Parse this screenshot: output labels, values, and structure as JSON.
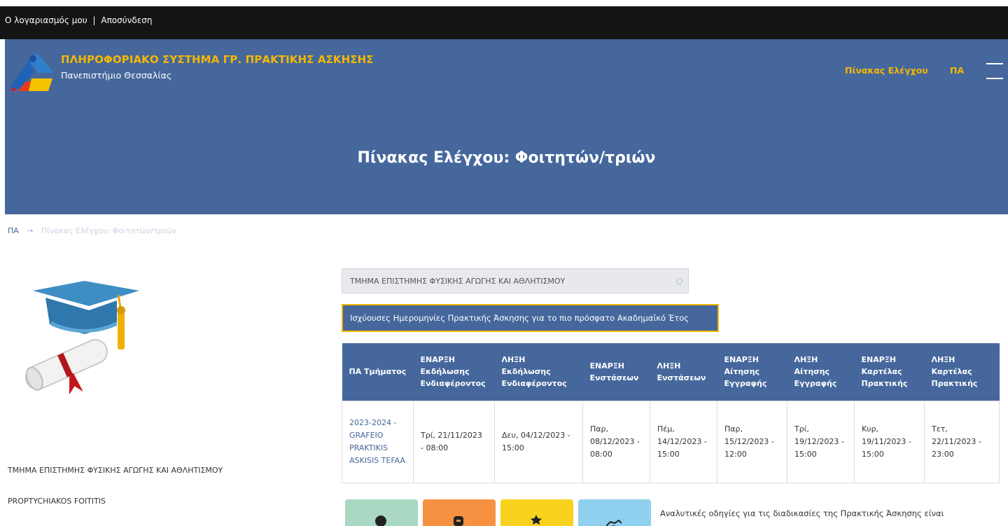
{
  "topbar": {
    "account_link": "Ο λογαριασμός μου",
    "separator": "|",
    "logout_link": "Αποσύνδεση"
  },
  "header": {
    "brand_title": "ΠΛΗΡΟΦΟΡΙΑΚΟ ΣΥΣΤΗΜΑ ΓΡ. ΠΡΑΚΤΙΚΗΣ ΑΣΚΗΣΗΣ",
    "brand_subtitle": "Πανεπιστήμιο Θεσσαλίας",
    "nav_dashboard": "Πίνακας Ελέγχου",
    "nav_pa": "ΠΑ",
    "page_title": "Πίνακας Ελέγχου: Φοιτητών/τριών"
  },
  "breadcrumb": {
    "home": "ΠΑ",
    "arrow": "→",
    "current": "Πίνακας Ελέγχου: Φοιτητών/τριών"
  },
  "sidebar": {
    "department": "ΤΜΗΜΑ ΕΠΙΣΤΗΜΗΣ ΦΥΣΙΚΗΣ ΑΓΩΓΗΣ ΚΑΙ ΑΘΛΗΤΙΣΜΟΥ",
    "role": "PROPTYCHIAKOS FOITITIS"
  },
  "main": {
    "department_select": "ΤΜΗΜΑ ΕΠΙΣΤΗΜΗΣ ΦΥΣΙΚΗΣ ΑΓΩΓΗΣ ΚΑΙ ΑΘΛΗΤΙΣΜΟΥ",
    "dates_banner": "Ισχύουσες Ημερομηνίες Πρακτικής Άσκησης για το πιο πρόσφατο Ακαδημαϊκό Έτος",
    "table": {
      "headers": [
        "ΠΑ Τμήματος",
        "ΕΝΑΡΞΗ Εκδήλωσης Ενδιαφέροντος",
        "ΛΗΞΗ Εκδήλωσης Ενδιαφέροντος",
        "ΕΝΑΡΞΗ Ενστάσεων",
        "ΛΗΞΗ Ενστάσεων",
        "ΕΝΑΡΞΗ Αίτησης Εγγραφής",
        "ΛΗΞΗ Αίτησης Εγγραφής",
        "ΕΝΑΡΞΗ Καρτέλας Πρακτικής",
        "ΛΗΞΗ Καρτέλας Πρακτικής"
      ],
      "rows": [
        [
          "2023-2024 - GRAFEIO PRAKTIKIS ASKISIS TEFAA",
          "Τρί, 21/11/2023 - 08:00",
          "Δευ, 04/12/2023 - 15:00",
          "Παρ, 08/12/2023 - 08:00",
          "Πέμ, 14/12/2023 - 15:00",
          "Παρ, 15/12/2023 - 12:00",
          "Τρί, 19/12/2023 - 15:00",
          "Κυρ, 19/11/2023 - 15:00",
          "Τετ, 22/11/2023 - 23:00"
        ]
      ]
    },
    "instructions": "Αναλυτικές οδηγίες για τις διαδικασίες της Πρακτικής Άσκησης είναι"
  },
  "tiles": [
    {
      "icon": "user-icon",
      "color": "#a9d9c3"
    },
    {
      "icon": "user-badge-icon",
      "color": "#f59140"
    },
    {
      "icon": "star-icon",
      "color": "#f8d21c"
    },
    {
      "icon": "handshake-icon",
      "color": "#8fd0ef"
    }
  ],
  "colors": {
    "header_bg": "#45679c",
    "accent": "#f5b700",
    "topbar_bg": "#141414"
  }
}
